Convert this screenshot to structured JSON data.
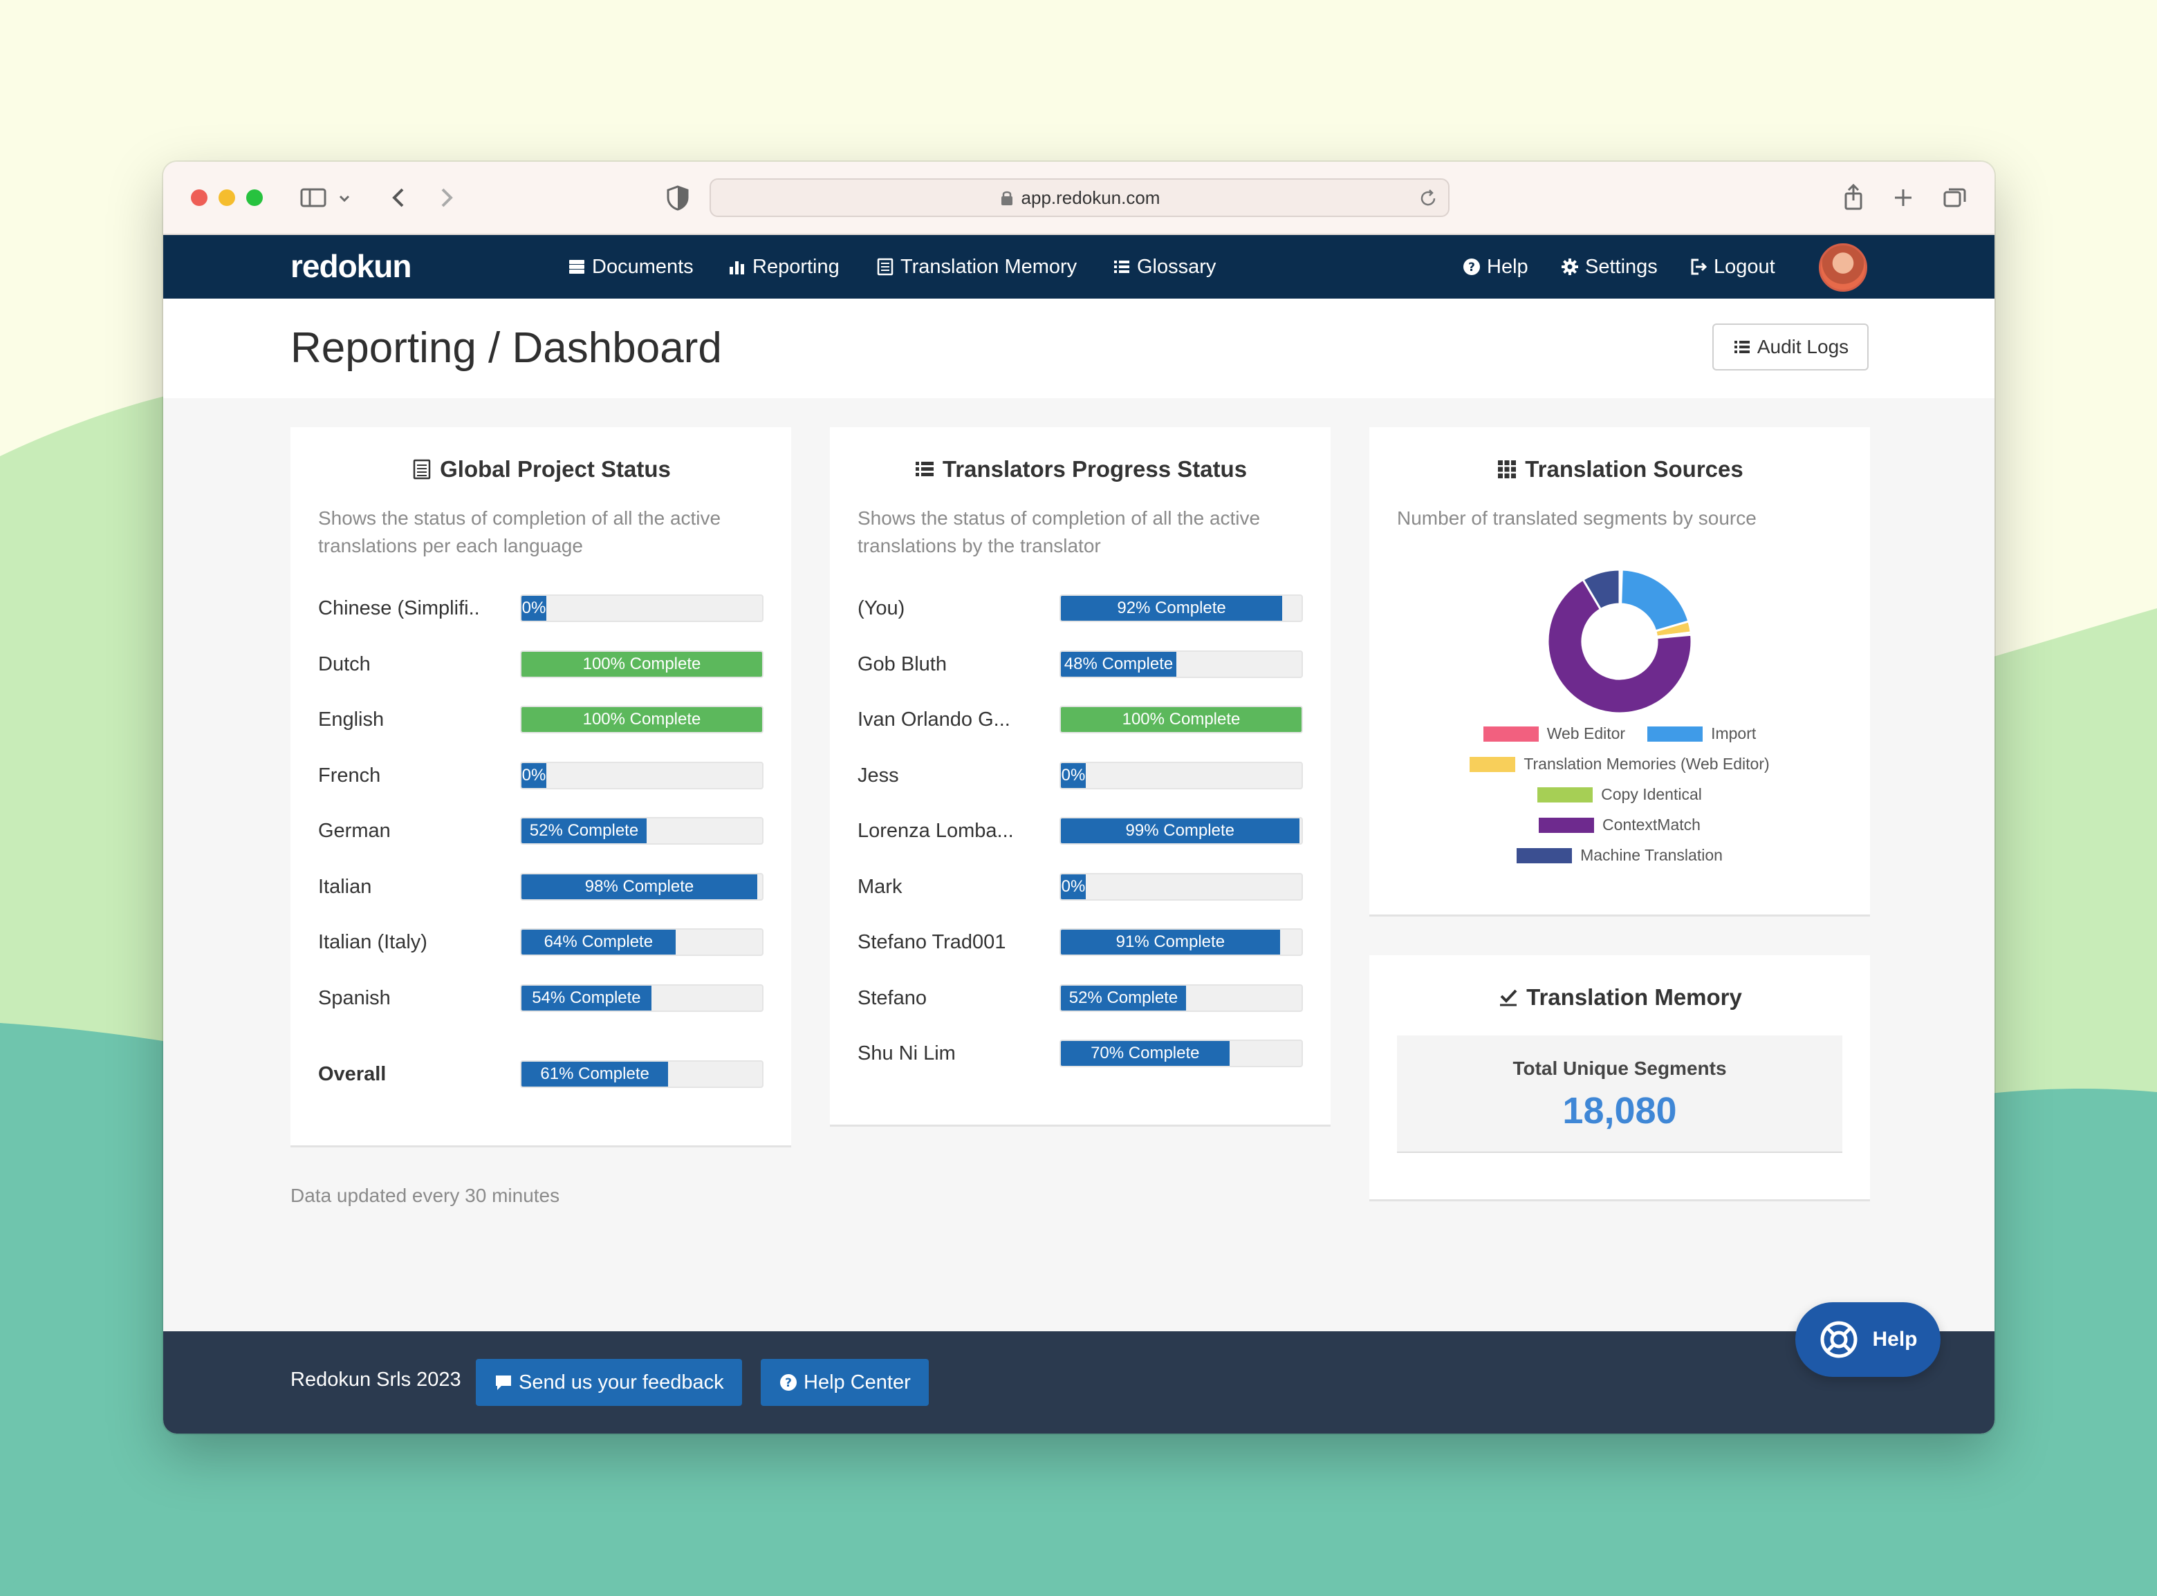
{
  "browser": {
    "url": "app.redokun.com"
  },
  "nav": {
    "logo": "redokun",
    "documents": "Documents",
    "reporting": "Reporting",
    "translation_memory": "Translation Memory",
    "glossary": "Glossary",
    "help": "Help",
    "settings": "Settings",
    "logout": "Logout"
  },
  "header": {
    "title": "Reporting / Dashboard",
    "audit_logs": "Audit Logs"
  },
  "global_status": {
    "title": "Global Project Status",
    "description": "Shows the status of completion of all the active translations per each language",
    "rows": [
      {
        "label": "Chinese (Simplifi..",
        "percent": 0,
        "text": "0%",
        "color": "blue"
      },
      {
        "label": "Dutch",
        "percent": 100,
        "text": "100% Complete",
        "color": "green"
      },
      {
        "label": "English",
        "percent": 100,
        "text": "100% Complete",
        "color": "green"
      },
      {
        "label": "French",
        "percent": 0,
        "text": "0%",
        "color": "blue"
      },
      {
        "label": "German",
        "percent": 52,
        "text": "52% Complete",
        "color": "blue"
      },
      {
        "label": "Italian",
        "percent": 98,
        "text": "98% Complete",
        "color": "blue"
      },
      {
        "label": "Italian (Italy)",
        "percent": 64,
        "text": "64% Complete",
        "color": "blue"
      },
      {
        "label": "Spanish",
        "percent": 54,
        "text": "54% Complete",
        "color": "blue"
      }
    ],
    "overall": {
      "label": "Overall",
      "percent": 61,
      "text": "61% Complete",
      "color": "blue"
    }
  },
  "translators_status": {
    "title": "Translators Progress Status",
    "description": "Shows the status of completion of all the active translations by the translator",
    "rows": [
      {
        "label": "(You)",
        "percent": 92,
        "text": "92% Complete",
        "color": "blue"
      },
      {
        "label": "Gob Bluth",
        "percent": 48,
        "text": "48% Complete",
        "color": "blue"
      },
      {
        "label": "Ivan Orlando G...",
        "percent": 100,
        "text": "100% Complete",
        "color": "green"
      },
      {
        "label": "Jess",
        "percent": 0,
        "text": "0%",
        "color": "blue"
      },
      {
        "label": "Lorenza Lomba...",
        "percent": 99,
        "text": "99% Complete",
        "color": "blue"
      },
      {
        "label": "Mark",
        "percent": 0,
        "text": "0%",
        "color": "blue"
      },
      {
        "label": "Stefano Trad001",
        "percent": 91,
        "text": "91% Complete",
        "color": "blue"
      },
      {
        "label": "Stefano",
        "percent": 52,
        "text": "52% Complete",
        "color": "blue"
      },
      {
        "label": "Shu Ni Lim",
        "percent": 70,
        "text": "70% Complete",
        "color": "blue"
      }
    ]
  },
  "translation_sources": {
    "title": "Translation Sources",
    "description": "Number of translated segments by source",
    "legend": {
      "web_editor": "Web Editor",
      "import": "Import",
      "tm_web_editor": "Translation Memories (Web Editor)",
      "copy_identical": "Copy Identical",
      "context_match": "ContextMatch",
      "machine_translation": "Machine Translation"
    },
    "colors": {
      "web_editor": "#f2607f",
      "import": "#3f9be8",
      "tm_web_editor": "#f8cf5a",
      "copy_identical": "#a6cf55",
      "context_match": "#6e2a8e",
      "machine_translation": "#3b4f91"
    }
  },
  "chart_data": {
    "type": "pie",
    "categories": [
      "Web Editor",
      "Import",
      "Translation Memories (Web Editor)",
      "Copy Identical",
      "ContextMatch",
      "Machine Translation"
    ],
    "values": [
      0.5,
      20,
      2.5,
      0.5,
      68,
      8.5
    ]
  },
  "translation_memory": {
    "title": "Translation Memory",
    "label": "Total Unique Segments",
    "value": "18,080"
  },
  "updated_note": "Data updated every 30 minutes",
  "footer": {
    "copyright": "Redokun Srls 2023",
    "feedback": "Send us your feedback",
    "help_center": "Help Center"
  },
  "help_fab": "Help"
}
